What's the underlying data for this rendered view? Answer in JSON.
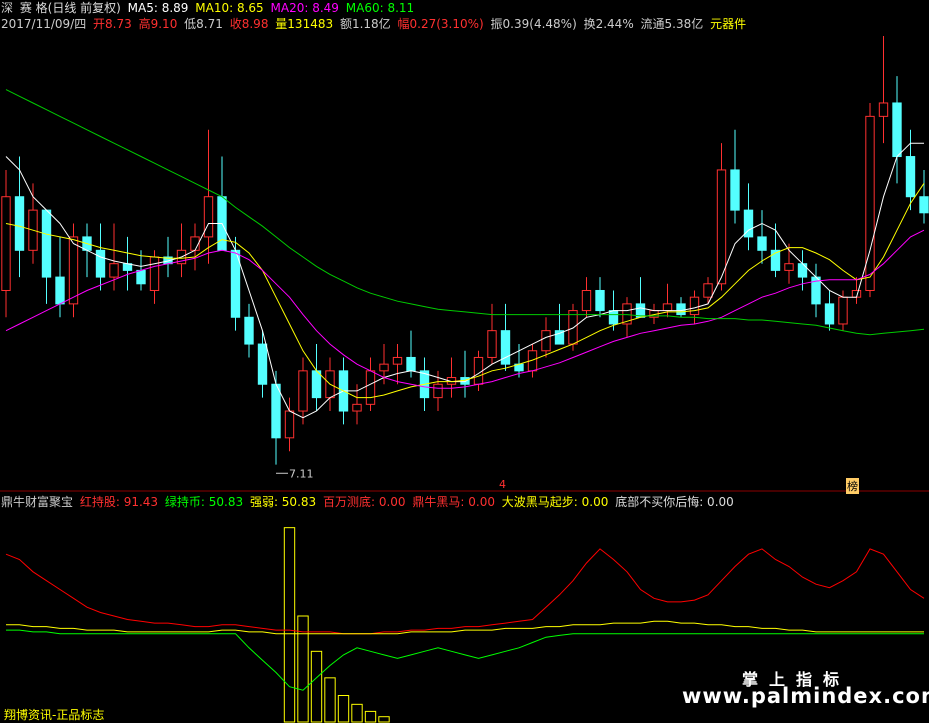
{
  "header": {
    "market": "深",
    "price_label": "赛 格(日线 前复权)",
    "ma5": "MA5: 8.89",
    "ma10": "MA10: 8.65",
    "ma20": "MA20: 8.49",
    "ma60": "MA60: 8.11",
    "date": "2017/11/09/四",
    "open": "开8.73",
    "high": "高9.10",
    "low": "低8.71",
    "close": "收8.98",
    "volume": "量131483",
    "amount": "额1.18亿",
    "change": "幅0.27(3.10%)",
    "amplitude": "振0.39(4.48%)",
    "turnover": "换2.44%",
    "float": "流通5.38亿",
    "sector": "元器件"
  },
  "indicator": {
    "name": "鼎牛财富聚宝",
    "hong": "红持股: 91.43",
    "lv": "绿持币: 50.83",
    "qr": "强弱: 50.83",
    "bw": "百万测底: 0.00",
    "dn": "鼎牛黑马: 0.00",
    "db": "大波黑马起步: 0.00",
    "dbu": "底部不买你后悔: 0.00"
  },
  "annotations": {
    "low_label": "7.11",
    "mark_left": "4",
    "mark_right": "榜"
  },
  "watermark": {
    "top_left": "翔博资讯-正品标志",
    "cn": "掌上指标",
    "url": "www.palmindex.com"
  },
  "colors": {
    "up": "#ff3030",
    "down": "#54ffff",
    "ma5": "#ffffff",
    "ma10": "#ffff00",
    "ma20": "#ff00ff",
    "ma60": "#00cc00",
    "separator": "#8b0000"
  },
  "chart_data": [
    {
      "type": "candlestick",
      "price_range": [
        7.0,
        10.3
      ],
      "lowest_point": 7.11,
      "ohlc": [
        [
          8.4,
          9.3,
          8.2,
          9.1
        ],
        [
          9.1,
          9.4,
          8.5,
          8.7
        ],
        [
          8.7,
          9.2,
          8.6,
          9.0
        ],
        [
          9.0,
          9.0,
          8.3,
          8.5
        ],
        [
          8.5,
          8.8,
          8.2,
          8.3
        ],
        [
          8.3,
          8.9,
          8.2,
          8.8
        ],
        [
          8.8,
          8.9,
          8.5,
          8.7
        ],
        [
          8.7,
          8.9,
          8.4,
          8.5
        ],
        [
          8.5,
          8.9,
          8.4,
          8.6
        ],
        [
          8.6,
          8.8,
          8.4,
          8.55
        ],
        [
          8.55,
          8.7,
          8.4,
          8.45
        ],
        [
          8.4,
          8.7,
          8.3,
          8.65
        ],
        [
          8.65,
          8.8,
          8.5,
          8.6
        ],
        [
          8.6,
          8.9,
          8.5,
          8.7
        ],
        [
          8.7,
          8.9,
          8.55,
          8.8
        ],
        [
          8.8,
          9.6,
          8.6,
          9.1
        ],
        [
          9.1,
          9.4,
          8.9,
          8.7
        ],
        [
          8.7,
          8.8,
          8.1,
          8.2
        ],
        [
          8.2,
          8.3,
          7.9,
          8.0
        ],
        [
          8.0,
          8.1,
          7.6,
          7.7
        ],
        [
          7.7,
          7.8,
          7.1,
          7.3
        ],
        [
          7.3,
          7.6,
          7.2,
          7.5
        ],
        [
          7.5,
          7.9,
          7.4,
          7.8
        ],
        [
          7.8,
          8.0,
          7.5,
          7.6
        ],
        [
          7.6,
          7.9,
          7.5,
          7.8
        ],
        [
          7.8,
          7.9,
          7.4,
          7.5
        ],
        [
          7.5,
          7.7,
          7.4,
          7.55
        ],
        [
          7.55,
          7.9,
          7.5,
          7.8
        ],
        [
          7.8,
          8.0,
          7.7,
          7.85
        ],
        [
          7.85,
          8.0,
          7.7,
          7.9
        ],
        [
          7.9,
          8.1,
          7.75,
          7.8
        ],
        [
          7.8,
          7.9,
          7.5,
          7.6
        ],
        [
          7.6,
          7.8,
          7.5,
          7.7
        ],
        [
          7.7,
          7.9,
          7.6,
          7.75
        ],
        [
          7.75,
          7.95,
          7.6,
          7.7
        ],
        [
          7.7,
          7.95,
          7.65,
          7.9
        ],
        [
          7.9,
          8.3,
          7.85,
          8.1
        ],
        [
          8.1,
          8.3,
          7.8,
          7.85
        ],
        [
          7.85,
          8.0,
          7.75,
          7.8
        ],
        [
          7.8,
          8.0,
          7.75,
          7.95
        ],
        [
          7.95,
          8.2,
          7.9,
          8.1
        ],
        [
          8.1,
          8.3,
          8.0,
          8.0
        ],
        [
          8.0,
          8.3,
          7.95,
          8.25
        ],
        [
          8.25,
          8.5,
          8.2,
          8.4
        ],
        [
          8.4,
          8.5,
          8.2,
          8.25
        ],
        [
          8.25,
          8.4,
          8.1,
          8.15
        ],
        [
          8.15,
          8.35,
          8.05,
          8.3
        ],
        [
          8.3,
          8.5,
          8.2,
          8.2
        ],
        [
          8.2,
          8.3,
          8.15,
          8.25
        ],
        [
          8.25,
          8.45,
          8.2,
          8.3
        ],
        [
          8.3,
          8.35,
          8.2,
          8.22
        ],
        [
          8.22,
          8.4,
          8.15,
          8.35
        ],
        [
          8.35,
          8.5,
          8.3,
          8.45
        ],
        [
          8.45,
          9.5,
          8.4,
          9.3
        ],
        [
          9.3,
          9.6,
          8.9,
          9.0
        ],
        [
          9.0,
          9.2,
          8.7,
          8.8
        ],
        [
          8.8,
          9.0,
          8.6,
          8.7
        ],
        [
          8.7,
          8.9,
          8.5,
          8.55
        ],
        [
          8.55,
          8.75,
          8.45,
          8.6
        ],
        [
          8.6,
          8.7,
          8.4,
          8.5
        ],
        [
          8.5,
          8.6,
          8.2,
          8.3
        ],
        [
          8.3,
          8.4,
          8.1,
          8.15
        ],
        [
          8.15,
          8.4,
          8.1,
          8.35
        ],
        [
          8.35,
          8.5,
          8.3,
          8.4
        ],
        [
          8.4,
          9.8,
          8.35,
          9.7
        ],
        [
          9.7,
          10.3,
          9.5,
          9.8
        ],
        [
          9.8,
          10.0,
          9.2,
          9.4
        ],
        [
          9.4,
          9.6,
          9.0,
          9.1
        ],
        [
          9.1,
          9.3,
          8.9,
          8.98
        ]
      ],
      "ma5": [
        9.4,
        9.3,
        9.1,
        9.0,
        8.9,
        8.75,
        8.7,
        8.65,
        8.62,
        8.6,
        8.58,
        8.6,
        8.62,
        8.65,
        8.7,
        8.9,
        8.9,
        8.7,
        8.4,
        8.1,
        7.7,
        7.5,
        7.45,
        7.5,
        7.6,
        7.65,
        7.65,
        7.7,
        7.75,
        7.78,
        7.8,
        7.78,
        7.75,
        7.72,
        7.72,
        7.78,
        7.85,
        7.9,
        7.95,
        8.0,
        8.05,
        8.08,
        8.12,
        8.2,
        8.22,
        8.25,
        8.25,
        8.27,
        8.25,
        8.25,
        8.25,
        8.27,
        8.3,
        8.5,
        8.75,
        8.85,
        8.9,
        8.85,
        8.7,
        8.6,
        8.5,
        8.4,
        8.35,
        8.35,
        8.7,
        9.1,
        9.4,
        9.5,
        9.5
      ],
      "ma10": [
        8.9,
        8.88,
        8.85,
        8.82,
        8.8,
        8.78,
        8.75,
        8.72,
        8.7,
        8.68,
        8.66,
        8.65,
        8.64,
        8.64,
        8.65,
        8.72,
        8.78,
        8.76,
        8.68,
        8.55,
        8.35,
        8.15,
        7.95,
        7.8,
        7.7,
        7.65,
        7.6,
        7.6,
        7.62,
        7.65,
        7.68,
        7.7,
        7.72,
        7.72,
        7.73,
        7.76,
        7.8,
        7.82,
        7.85,
        7.88,
        7.92,
        7.96,
        8.0,
        8.05,
        8.1,
        8.14,
        8.17,
        8.2,
        8.22,
        8.24,
        8.24,
        8.25,
        8.27,
        8.35,
        8.45,
        8.55,
        8.62,
        8.68,
        8.72,
        8.72,
        8.68,
        8.63,
        8.55,
        8.48,
        8.5,
        8.65,
        8.85,
        9.05,
        9.2
      ],
      "ma20": [
        8.1,
        8.15,
        8.2,
        8.25,
        8.3,
        8.35,
        8.4,
        8.44,
        8.48,
        8.52,
        8.55,
        8.58,
        8.6,
        8.62,
        8.64,
        8.68,
        8.7,
        8.68,
        8.63,
        8.55,
        8.45,
        8.35,
        8.22,
        8.1,
        8.0,
        7.92,
        7.85,
        7.8,
        7.75,
        7.72,
        7.7,
        7.68,
        7.67,
        7.67,
        7.68,
        7.7,
        7.72,
        7.75,
        7.78,
        7.8,
        7.83,
        7.86,
        7.9,
        7.94,
        7.98,
        8.02,
        8.05,
        8.08,
        8.1,
        8.12,
        8.14,
        8.15,
        8.17,
        8.2,
        8.25,
        8.3,
        8.35,
        8.38,
        8.42,
        8.45,
        8.47,
        8.48,
        8.48,
        8.48,
        8.52,
        8.6,
        8.7,
        8.8,
        8.85
      ],
      "ma60": [
        9.9,
        9.85,
        9.8,
        9.75,
        9.7,
        9.65,
        9.6,
        9.55,
        9.5,
        9.45,
        9.4,
        9.35,
        9.3,
        9.25,
        9.2,
        9.15,
        9.1,
        9.02,
        8.95,
        8.88,
        8.8,
        8.72,
        8.65,
        8.58,
        8.52,
        8.47,
        8.42,
        8.38,
        8.35,
        8.32,
        8.3,
        8.28,
        8.26,
        8.25,
        8.24,
        8.23,
        8.22,
        8.22,
        8.22,
        8.22,
        8.22,
        8.22,
        8.22,
        8.22,
        8.22,
        8.22,
        8.22,
        8.21,
        8.21,
        8.21,
        8.2,
        8.2,
        8.19,
        8.19,
        8.19,
        8.18,
        8.18,
        8.17,
        8.16,
        8.15,
        8.14,
        8.12,
        8.1,
        8.08,
        8.07,
        8.08,
        8.09,
        8.1,
        8.11
      ]
    },
    {
      "type": "line",
      "indicator_range": [
        0,
        120
      ],
      "series": [
        {
          "name": "红持股",
          "color": "#ff0000",
          "values": [
            95,
            92,
            85,
            80,
            75,
            70,
            65,
            62,
            60,
            58,
            57,
            56,
            56,
            55,
            54,
            54,
            55,
            55,
            54,
            53,
            52,
            52,
            51,
            51,
            51,
            50,
            50,
            50,
            51,
            51,
            52,
            52,
            53,
            53,
            54,
            54,
            55,
            56,
            57,
            58,
            65,
            72,
            80,
            90,
            98,
            92,
            85,
            75,
            70,
            68,
            68,
            69,
            72,
            80,
            88,
            95,
            98,
            92,
            88,
            82,
            78,
            76,
            80,
            85,
            98,
            95,
            85,
            75,
            70
          ]
        },
        {
          "name": "绿持币",
          "color": "#00ff00",
          "values": [
            52,
            52,
            51,
            51,
            50,
            50,
            50,
            50,
            50,
            50,
            50,
            50,
            50,
            50,
            50,
            50,
            50,
            50,
            42,
            35,
            28,
            20,
            18,
            25,
            32,
            38,
            42,
            40,
            38,
            36,
            38,
            40,
            42,
            40,
            38,
            36,
            38,
            40,
            42,
            45,
            48,
            49,
            50,
            50,
            50,
            50,
            50,
            50,
            50,
            50,
            50,
            50,
            50,
            50,
            50,
            50,
            50,
            50,
            50,
            50,
            50,
            50,
            50,
            50,
            50,
            50,
            50,
            50,
            50
          ]
        },
        {
          "name": "强弱",
          "color": "#ffff00",
          "values": [
            55,
            55,
            54,
            54,
            53,
            53,
            52,
            52,
            52,
            51,
            51,
            51,
            51,
            51,
            51,
            51,
            52,
            52,
            51,
            51,
            50,
            50,
            50,
            50,
            50,
            50,
            50,
            50,
            50,
            50,
            51,
            51,
            51,
            51,
            52,
            52,
            52,
            53,
            53,
            53,
            54,
            54,
            55,
            55,
            55,
            56,
            56,
            56,
            57,
            57,
            56,
            56,
            55,
            55,
            54,
            54,
            53,
            53,
            52,
            52,
            51,
            51,
            51,
            51,
            51,
            51,
            51,
            51,
            51
          ]
        }
      ],
      "bars": [
        0,
        0,
        0,
        0,
        0,
        0,
        0,
        0,
        0,
        0,
        0,
        0,
        0,
        0,
        0,
        0,
        0,
        0,
        0,
        0,
        0,
        110,
        60,
        40,
        25,
        15,
        10,
        6,
        3,
        0,
        0,
        0,
        0,
        0,
        0,
        0,
        0,
        0,
        0,
        0,
        0,
        0,
        0,
        0,
        0,
        0,
        0,
        0,
        0,
        0,
        0,
        0,
        0,
        0,
        0,
        0,
        0,
        0,
        0,
        0,
        0,
        0,
        0,
        0,
        0,
        0,
        0,
        0,
        0
      ]
    }
  ]
}
